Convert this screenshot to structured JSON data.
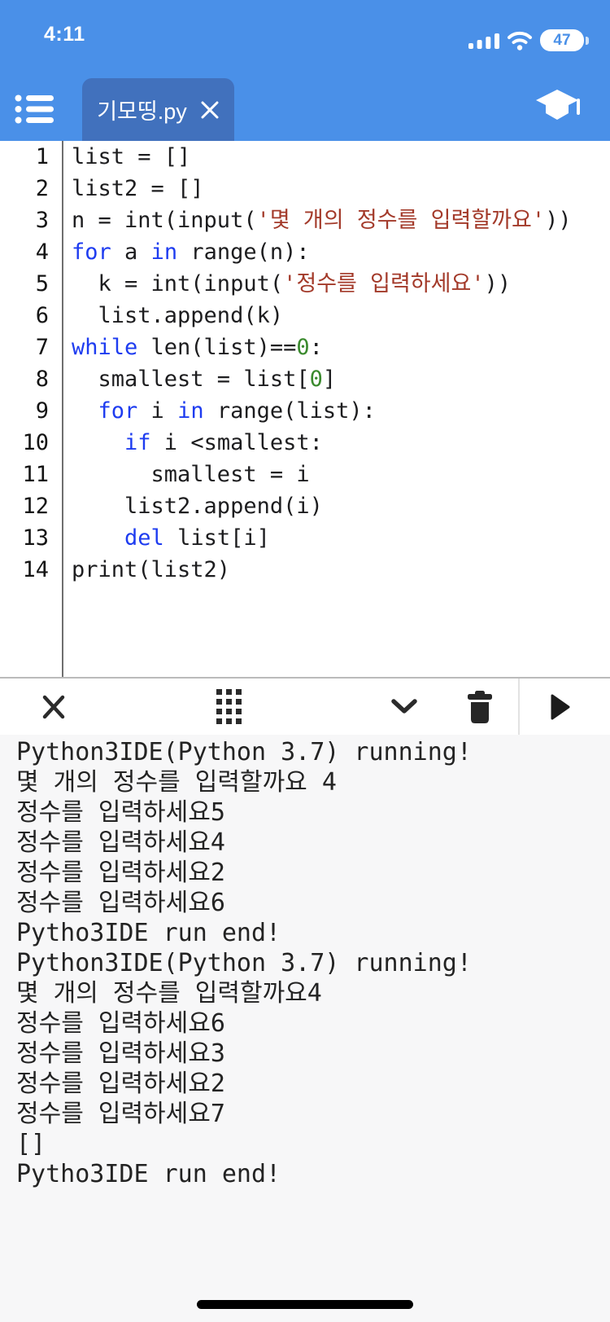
{
  "status_bar": {
    "time": "4:11",
    "battery_percent": "47",
    "icons": [
      "cellular-signal-icon",
      "wifi-icon",
      "battery-icon"
    ]
  },
  "nav": {
    "tab": {
      "title": "기모띵.py"
    },
    "icons": [
      "menu-list-icon",
      "tab-close-icon",
      "graduation-cap-icon"
    ]
  },
  "editor": {
    "lines": [
      {
        "num": "1",
        "tokens": [
          [
            "p",
            "list = []"
          ]
        ]
      },
      {
        "num": "2",
        "tokens": [
          [
            "p",
            "list2 = []"
          ]
        ]
      },
      {
        "num": "3",
        "tokens": [
          [
            "p",
            "n = int(input("
          ],
          [
            "s",
            "'몇 개의 정수를 입력할까요'"
          ],
          [
            "p",
            "))"
          ]
        ]
      },
      {
        "num": "4",
        "tokens": [
          [
            "k",
            "for"
          ],
          [
            "p",
            " a "
          ],
          [
            "k",
            "in"
          ],
          [
            "p",
            " range(n):"
          ]
        ]
      },
      {
        "num": "5",
        "tokens": [
          [
            "p",
            "  k = int(input("
          ],
          [
            "s",
            "'정수를 입력하세요'"
          ],
          [
            "p",
            "))"
          ]
        ]
      },
      {
        "num": "6",
        "tokens": [
          [
            "p",
            "  list.append(k)"
          ]
        ]
      },
      {
        "num": "7",
        "tokens": [
          [
            "k",
            "while"
          ],
          [
            "p",
            " len(list)=="
          ],
          [
            "n",
            "0"
          ],
          [
            "p",
            ":"
          ]
        ]
      },
      {
        "num": "8",
        "tokens": [
          [
            "p",
            "  smallest = list["
          ],
          [
            "n",
            "0"
          ],
          [
            "p",
            "]"
          ]
        ]
      },
      {
        "num": "9",
        "tokens": [
          [
            "p",
            "  "
          ],
          [
            "k",
            "for"
          ],
          [
            "p",
            " i "
          ],
          [
            "k",
            "in"
          ],
          [
            "p",
            " range(list):"
          ]
        ]
      },
      {
        "num": "10",
        "tokens": [
          [
            "p",
            "    "
          ],
          [
            "k",
            "if"
          ],
          [
            "p",
            " i <smallest:"
          ]
        ]
      },
      {
        "num": "11",
        "tokens": [
          [
            "p",
            "      smallest = i"
          ]
        ]
      },
      {
        "num": "12",
        "tokens": [
          [
            "p",
            "    list2.append(i)"
          ]
        ]
      },
      {
        "num": "13",
        "tokens": [
          [
            "p",
            "    "
          ],
          [
            "k",
            "del"
          ],
          [
            "p",
            " list[i]"
          ]
        ]
      },
      {
        "num": "14",
        "tokens": [
          [
            "p",
            "print(list2)"
          ]
        ]
      }
    ]
  },
  "toolbar": {
    "icons": [
      "close-icon",
      "keypad-grid-icon",
      "chevron-down-icon",
      "trash-icon",
      "play-icon"
    ]
  },
  "console": {
    "lines": [
      "Python3IDE(Python 3.7) running!",
      "몇 개의 정수를 입력할까요 4",
      "정수를 입력하세요5",
      "정수를 입력하세요4",
      "정수를 입력하세요2",
      "정수를 입력하세요6",
      "Pytho3IDE run end!",
      "Python3IDE(Python 3.7) running!",
      "몇 개의 정수를 입력할까요4",
      "정수를 입력하세요6",
      "정수를 입력하세요3",
      "정수를 입력하세요2",
      "정수를 입력하세요7",
      "[]",
      "Pytho3IDE run end!"
    ]
  },
  "colors": {
    "header": "#4a90e8",
    "tab": "#4171bd",
    "keyword": "#1e3cf0",
    "string": "#a33a2a",
    "number": "#3a8a2d",
    "console_bg": "#f7f7f8"
  }
}
